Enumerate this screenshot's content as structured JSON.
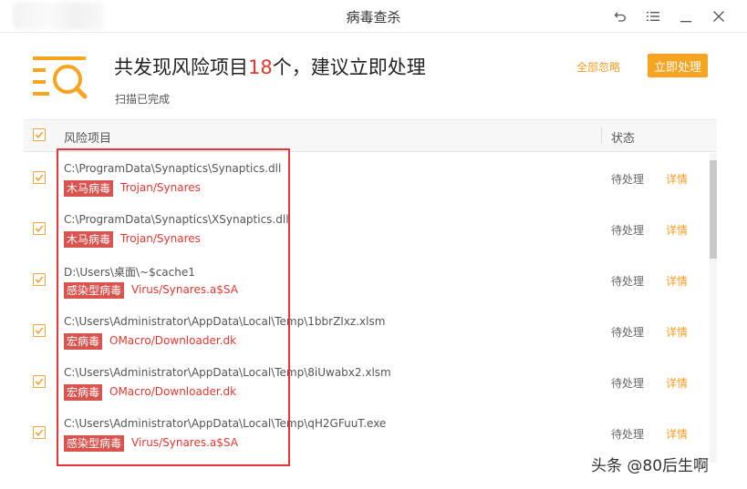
{
  "window": {
    "title": "病毒查杀"
  },
  "header": {
    "headline_prefix": "共发现风险项目",
    "headline_count": "18",
    "headline_suffix": "个，建议立即处理",
    "status_text": "扫描已完成",
    "ignore_all_label": "全部忽略",
    "process_now_label": "立即处理"
  },
  "table": {
    "col_item": "风险项目",
    "col_status": "状态",
    "rows": [
      {
        "path": "C:\\ProgramData\\Synaptics\\Synaptics.dll",
        "tag": "木马病毒",
        "virus": "Trojan/Synares",
        "status": "待处理",
        "action": "详情"
      },
      {
        "path": "C:\\ProgramData\\Synaptics\\XSynaptics.dll",
        "tag": "木马病毒",
        "virus": "Trojan/Synares",
        "status": "待处理",
        "action": "详情"
      },
      {
        "path": "D:\\Users\\桌面\\~$cache1",
        "tag": "感染型病毒",
        "virus": "Virus/Synares.a$SA",
        "status": "待处理",
        "action": "详情"
      },
      {
        "path": "C:\\Users\\Administrator\\AppData\\Local\\Temp\\1bbrZIxz.xlsm",
        "tag": "宏病毒",
        "virus": "OMacro/Downloader.dk",
        "status": "待处理",
        "action": "详情"
      },
      {
        "path": "C:\\Users\\Administrator\\AppData\\Local\\Temp\\8iUwabx2.xlsm",
        "tag": "宏病毒",
        "virus": "OMacro/Downloader.dk",
        "status": "待处理",
        "action": "详情"
      },
      {
        "path": "C:\\Users\\Administrator\\AppData\\Local\\Temp\\qH2GFuuT.exe",
        "tag": "感染型病毒",
        "virus": "Virus/Synares.a$SA",
        "status": "待处理",
        "action": "详情"
      }
    ]
  },
  "watermark": "头条 @80后生啊",
  "colors": {
    "accent_orange": "#f7a521",
    "danger_red": "#e8362f",
    "tag_red": "#d9534f",
    "highlight_red": "#e63636"
  },
  "icons": [
    "undo-icon",
    "menu-icon",
    "minimize-icon",
    "close-icon",
    "scan-list-icon",
    "checkmark-icon"
  ]
}
